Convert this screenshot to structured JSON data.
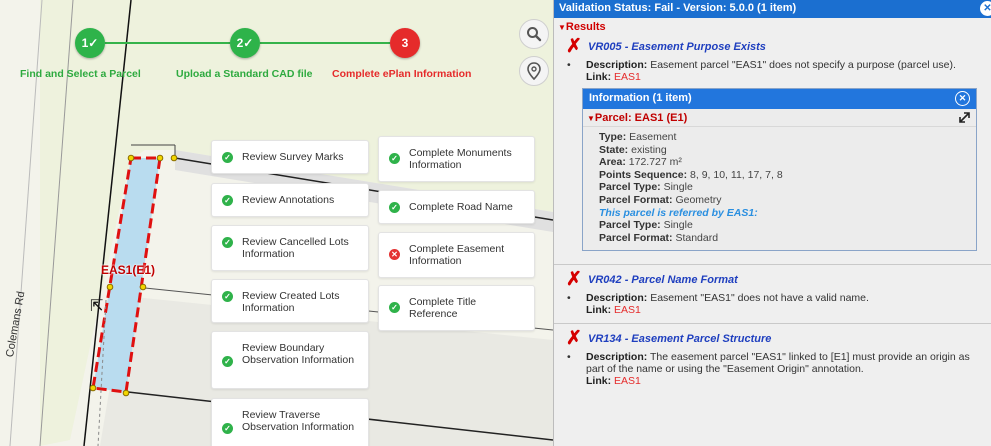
{
  "map": {
    "road_name": "Colemans Rd",
    "parcel_label": "EAS1(E1)"
  },
  "stepper": {
    "steps": [
      {
        "number": "1✓",
        "label": "Find and Select a Parcel",
        "state": "done"
      },
      {
        "number": "2✓",
        "label": "Upload a Standard CAD file",
        "state": "done"
      },
      {
        "number": "3",
        "label": "Complete ePlan Information",
        "state": "active"
      }
    ],
    "colors": {
      "done": "#2eb34a",
      "active": "#e52b2b"
    }
  },
  "tools": [
    {
      "name": "search-icon"
    },
    {
      "name": "location-pin-icon"
    }
  ],
  "tasks": {
    "left": [
      {
        "label": "Review Survey Marks",
        "status": "ok"
      },
      {
        "label": "Review Annotations",
        "status": "ok"
      },
      {
        "label": "Review Cancelled Lots Information",
        "status": "ok"
      },
      {
        "label": "Review Created Lots Information",
        "status": "ok"
      },
      {
        "label": "Review Boundary Observation Information",
        "status": "ok"
      },
      {
        "label": "Review Traverse Observation Information",
        "status": "ok"
      }
    ],
    "right": [
      {
        "label": "Complete Monuments Information",
        "status": "ok"
      },
      {
        "label": "Complete Road Name",
        "status": "ok"
      },
      {
        "label": "Complete Easement Information",
        "status": "error"
      },
      {
        "label": "Complete Title Reference",
        "status": "ok"
      }
    ]
  },
  "panel": {
    "header": "Validation Status: Fail - Version: 5.0.0 (1 item)",
    "results_label": "Results",
    "rules": [
      {
        "code": "VR005 - Easement Purpose Exists",
        "description_label": "Description:",
        "description": "Easement parcel \"EAS1\" does not specify a purpose (parcel use).",
        "link_label": "Link:",
        "link": "EAS1"
      },
      {
        "code": "VR042 - Parcel Name Format",
        "description_label": "Description:",
        "description": "Easement \"EAS1\" does not have a valid name.",
        "link_label": "Link:",
        "link": "EAS1"
      },
      {
        "code": "VR134 - Easement Parcel Structure",
        "description_label": "Description:",
        "description": "The easement parcel \"EAS1\" linked to [E1] must provide an origin as part of the name or using the \"Easement Origin\" annotation.",
        "link_label": "Link:",
        "link": "EAS1"
      }
    ],
    "info": {
      "header": "Information (1 item)",
      "parcel_title": "Parcel: EAS1 (E1)",
      "props": [
        {
          "label": "Type:",
          "value": "Easement"
        },
        {
          "label": "State:",
          "value": "existing"
        },
        {
          "label": "Area:",
          "value": "172.727 m²"
        },
        {
          "label": "Points Sequence:",
          "value": "8, 9, 10, 11, 17, 7, 8"
        },
        {
          "label": "Parcel Type:",
          "value": "Single"
        },
        {
          "label": "Parcel Format:",
          "value": "Geometry"
        }
      ],
      "referred_by": "This parcel is referred by EAS1:",
      "ref_props": [
        {
          "label": "Parcel Type:",
          "value": "Single"
        },
        {
          "label": "Parcel Format:",
          "value": "Standard"
        }
      ]
    },
    "colors": {
      "header": "#1b6fd0",
      "error": "#d50000",
      "rule_title": "#1f3fbf"
    }
  }
}
